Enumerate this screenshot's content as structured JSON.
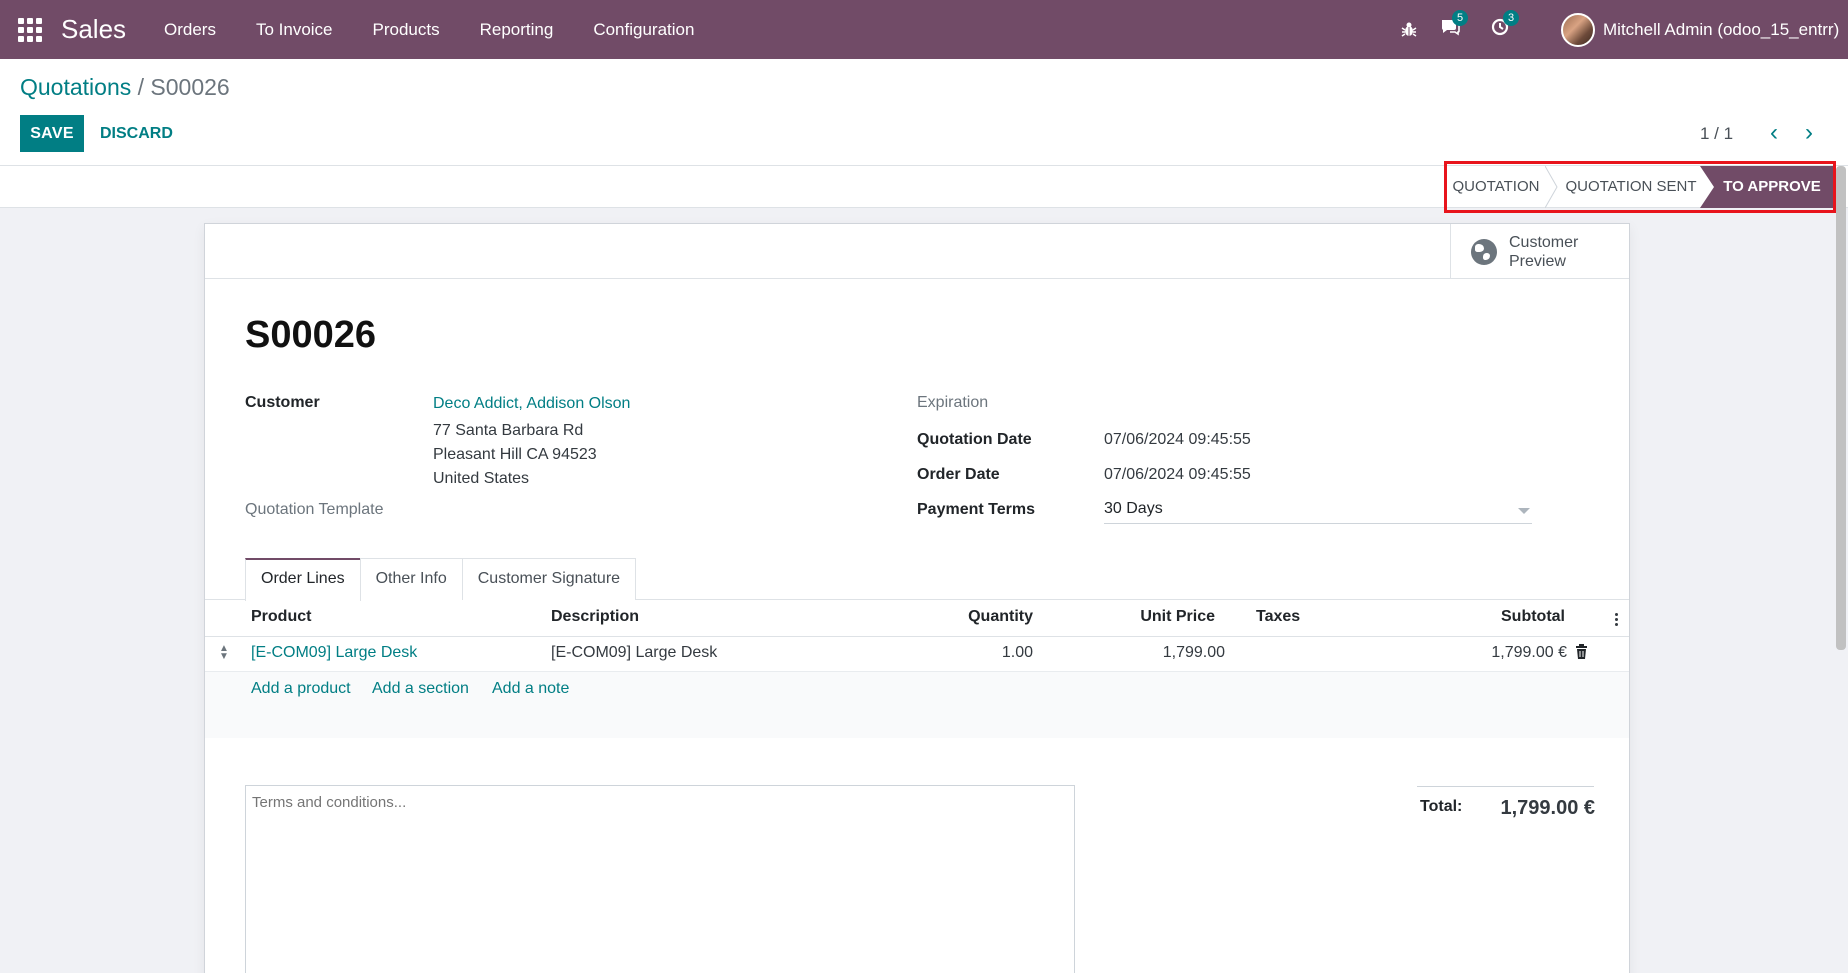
{
  "navbar": {
    "app_name": "Sales",
    "menu": [
      "Orders",
      "To Invoice",
      "Products",
      "Reporting",
      "Configuration"
    ],
    "messages_count": "5",
    "activities_count": "3",
    "user_name": "Mitchell Admin (odoo_15_entrr)",
    "bg_color": "#714b67"
  },
  "control_panel": {
    "breadcrumb_parent": "Quotations",
    "breadcrumb_sep": "/",
    "breadcrumb_current": "S00026",
    "save_label": "SAVE",
    "discard_label": "DISCARD",
    "pager": "1 / 1"
  },
  "statusbar": {
    "stages": [
      "QUOTATION",
      "QUOTATION SENT",
      "TO APPROVE"
    ],
    "active_stage": "TO APPROVE"
  },
  "sheet": {
    "preview_label": "Customer Preview",
    "record_name": "S00026",
    "customer_label": "Customer",
    "customer_name": "Deco Addict, Addison Olson",
    "address_line1": "77 Santa Barbara Rd",
    "address_line2": "Pleasant Hill CA 94523",
    "address_line3": "United States",
    "template_label": "Quotation Template",
    "expiration_label": "Expiration",
    "quotation_date_label": "Quotation Date",
    "quotation_date": "07/06/2024 09:45:55",
    "order_date_label": "Order Date",
    "order_date": "07/06/2024 09:45:55",
    "payment_terms_label": "Payment Terms",
    "payment_terms": "30 Days"
  },
  "tabs": [
    "Order Lines",
    "Other Info",
    "Customer Signature"
  ],
  "lines_table": {
    "headers": {
      "product": "Product",
      "description": "Description",
      "quantity": "Quantity",
      "unit_price": "Unit Price",
      "taxes": "Taxes",
      "subtotal": "Subtotal"
    },
    "rows": [
      {
        "product": "[E-COM09] Large Desk",
        "description": "[E-COM09] Large Desk",
        "quantity": "1.00",
        "unit_price": "1,799.00",
        "taxes": "",
        "subtotal": "1,799.00 €"
      }
    ],
    "add_product": "Add a product",
    "add_section": "Add a section",
    "add_note": "Add a note"
  },
  "footer": {
    "terms_placeholder": "Terms and conditions...",
    "total_label": "Total:",
    "total_value": "1,799.00 €"
  }
}
